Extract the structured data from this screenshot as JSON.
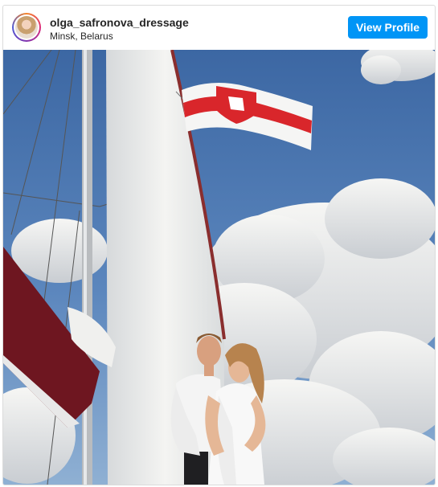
{
  "profile": {
    "username": "olga_safronova_dressage",
    "location": "Minsk, Belarus",
    "view_profile_label": "View Profile"
  },
  "icons": {
    "avatar": "profile-avatar",
    "flag": "white-red-white-flag"
  },
  "colors": {
    "button": "#0095f6",
    "text": "#262626",
    "border": "#dbdbdb",
    "sky": "#4a73ad",
    "flag_red": "#d9262b"
  }
}
